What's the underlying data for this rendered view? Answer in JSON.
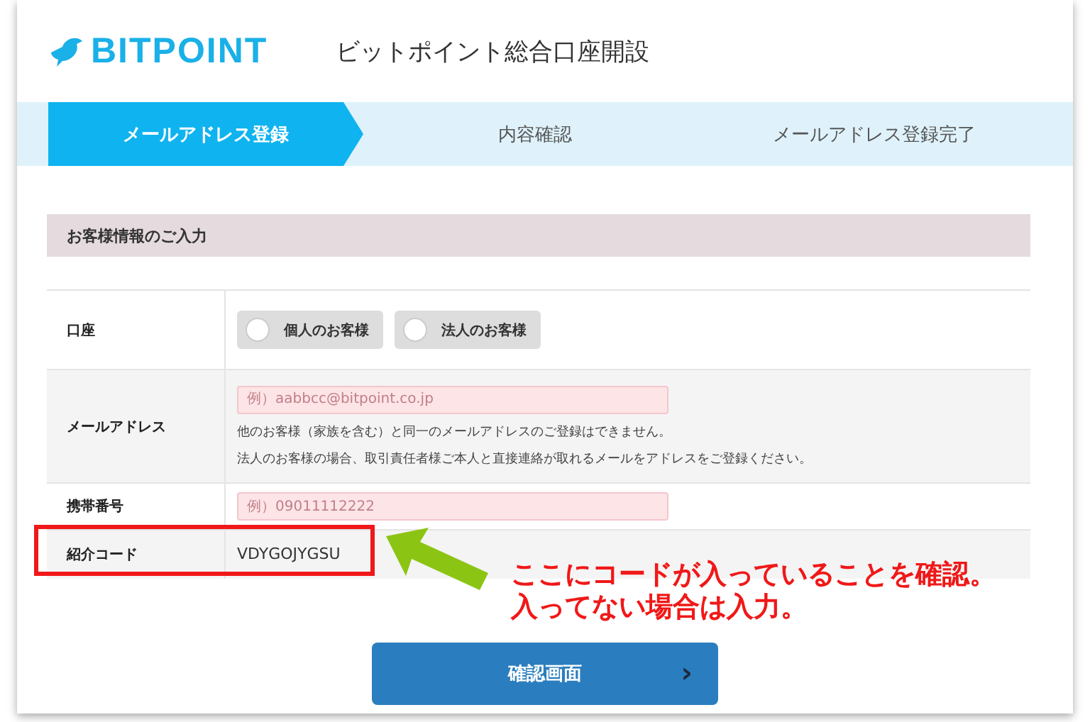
{
  "header": {
    "logo": "BITPOINT",
    "title": "ビットポイント総合口座開設"
  },
  "steps": [
    {
      "label": "メールアドレス登録",
      "selected": true
    },
    {
      "label": "内容確認",
      "selected": false
    },
    {
      "label": "メールアドレス登録完了",
      "selected": false
    }
  ],
  "section": {
    "title": "お客様情報のご入力"
  },
  "form": [
    {
      "kind": "radios",
      "label": "口座",
      "options": [
        {
          "label": "個人のお客様",
          "checked": false
        },
        {
          "label": "法人のお客様",
          "checked": false
        }
      ]
    },
    {
      "kind": "input",
      "label": "メールアドレス",
      "placeholder": "例）aabbcc@bitpoint.co.jp",
      "notes": [
        "他のお客様（家族を含む）と同一のメールアドレスのご登録はできません。",
        "法人のお客様の場合、取引責任者様ご本人と直接連絡が取れるメールをアドレスをご登録ください。"
      ]
    },
    {
      "kind": "input",
      "label": "携帯番号",
      "placeholder": "例）09011112222"
    },
    {
      "kind": "value",
      "label": "紹介コード",
      "value": "VDYGOJYGSU"
    }
  ],
  "submit": {
    "label": "確認画面",
    "chevron": "›"
  },
  "annotation": {
    "lines": [
      "ここにコードが入っていることを確認。",
      "入ってない場合は入力。"
    ]
  }
}
